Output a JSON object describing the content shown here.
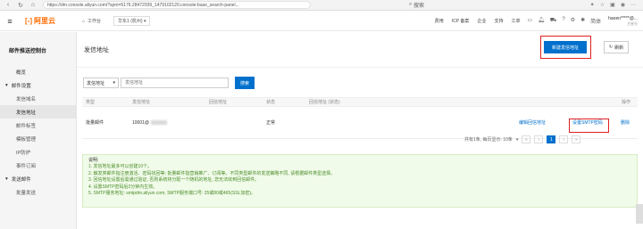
{
  "browser": {
    "url": "https://dm.console.aliyun.com/?spm=5176.28472939_1479102120.console-base_search-panel...",
    "search_label": "搜索"
  },
  "topbar": {
    "logo_text": "阿里云",
    "workbench": "工作台",
    "region": "华东1 (杭州)",
    "links": [
      "费用",
      "ICP 备案",
      "企业",
      "支持",
      "工单"
    ],
    "lang": "简体",
    "user_name": "haoen*****@...",
    "user_sub": "主账号"
  },
  "sidebar": {
    "title": "邮件推送控制台",
    "overview": "概览",
    "group1": "邮件设置",
    "items": [
      "发信域名",
      "发信地址",
      "邮件标签",
      "模板管理",
      "IP防护",
      "事件订阅"
    ],
    "active_index": 1,
    "group2": "发送邮件",
    "group2_items": [
      "批量发送"
    ]
  },
  "main": {
    "title": "发信地址",
    "new_button": "新建发信地址",
    "refresh_button": "刷新",
    "filter_select": "发信地址",
    "search_placeholder": "发信地址",
    "search_button": "搜索",
    "columns": [
      "类型",
      "发信地址",
      "回信地址",
      "状态",
      "回信地址 (状态)",
      "操作"
    ],
    "row": {
      "type": "批量邮件",
      "address": "10001@",
      "status": "正常",
      "action_edit": "编辑回信地址",
      "action_smtp": "设置SMTP密码",
      "action_delete": "删除"
    },
    "pager_text": "共有1条, 每页显示: 10条",
    "pager_current": "1"
  },
  "notice": {
    "title": "说明:",
    "lines": [
      "1. 发信地址最多可以创建10个。",
      "2. 触发类邮件指注册激活、密码找回等; 批量邮件指营销推广、订阅等。不同类型邮件的发送策略不同, 请根据邮件类型选择。",
      "3. 回信地址设置后需通过验证, 否则系统将分配一个随机的地址, 您无法收到回信邮件。",
      "4. 设置SMTP密码后2分钟内生效。",
      "5. SMTP服务地址: smtpdm.aliyun.com, SMTP服务端口号: 25或80或465(SSL加密)。"
    ]
  }
}
